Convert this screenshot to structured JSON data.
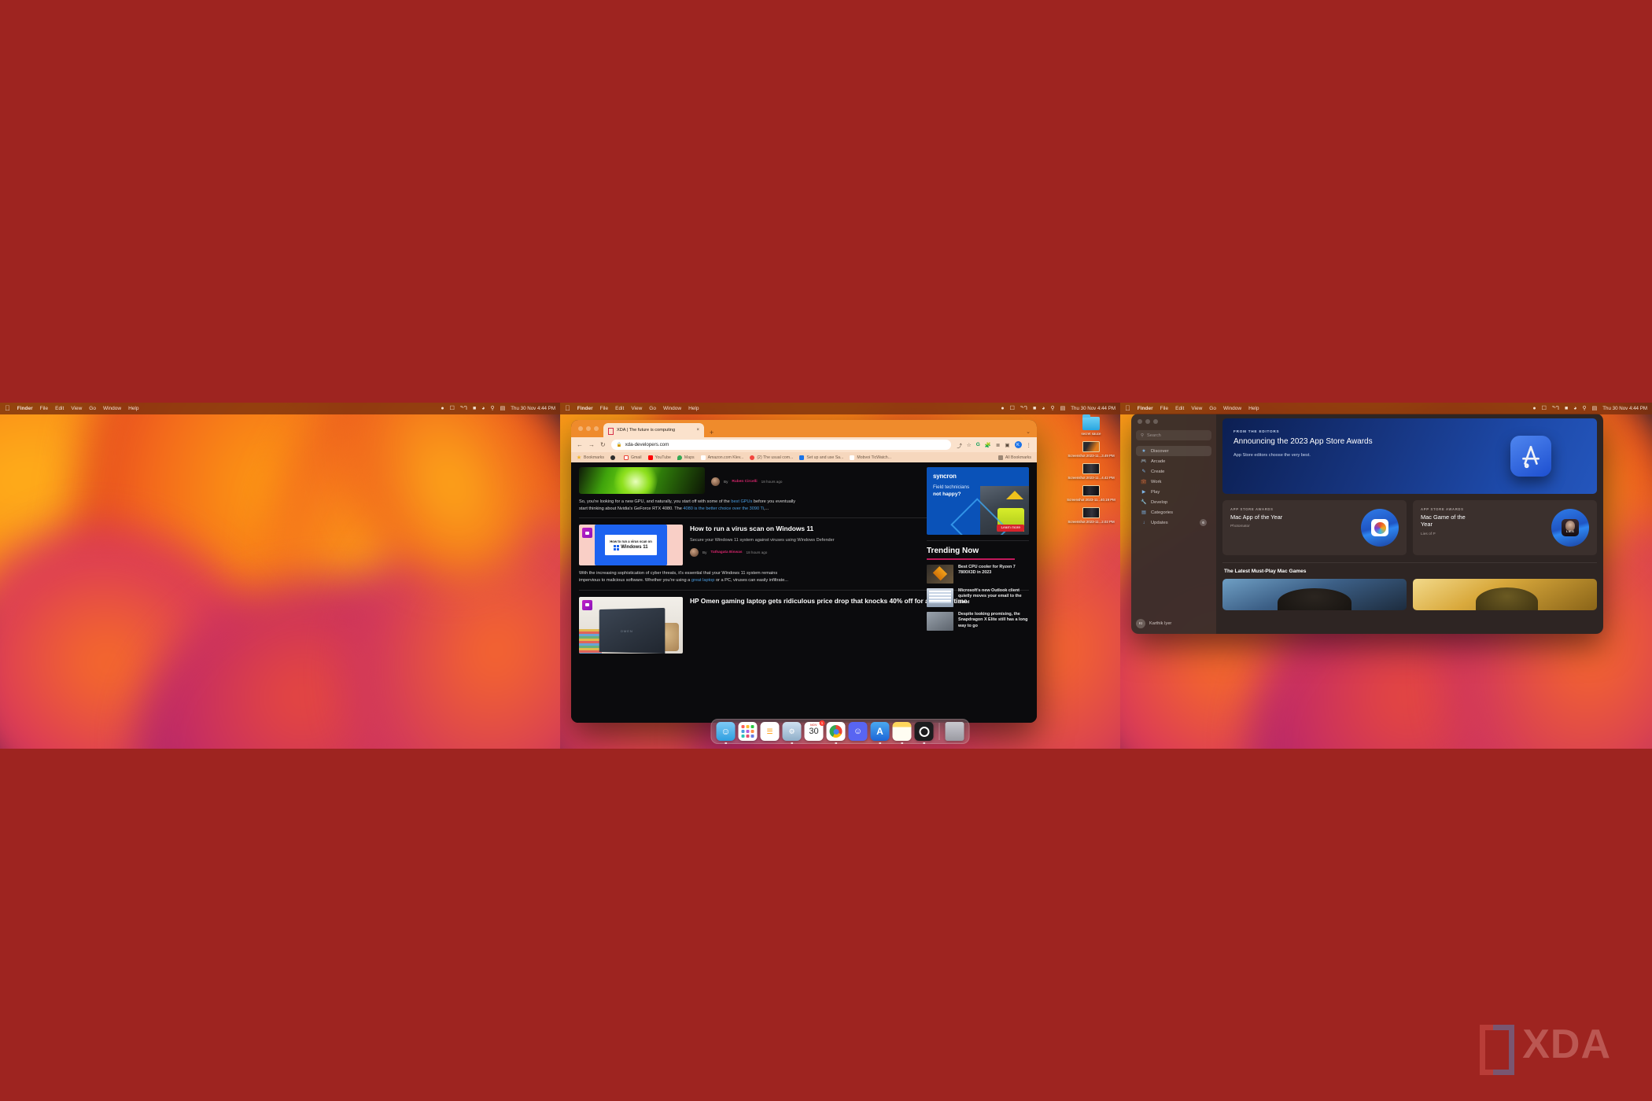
{
  "desktop": {
    "wallpaper_name": "macOS Ventura",
    "background_color": "#9e2420",
    "watermark": "XDA"
  },
  "menubar": {
    "apple": "",
    "items": [
      "Finder",
      "File",
      "Edit",
      "View",
      "Go",
      "Window",
      "Help"
    ],
    "status_icons": [
      "do-not-disturb-icon",
      "screen-mirroring-icon",
      "bluetooth-icon",
      "battery-icon",
      "wifi-icon",
      "search-icon",
      "control-center-icon"
    ],
    "clock": "Thu 30 Nov  4:44 PM"
  },
  "browser": {
    "traffic_lights": [
      "close",
      "minimize",
      "zoom"
    ],
    "tab": {
      "title": "XDA | The future is computing",
      "favicon": "xda-bracket-icon",
      "close": "×"
    },
    "new_tab": "+",
    "tab_list_chevron": "⌄",
    "toolbar": {
      "back": "←",
      "forward": "→",
      "reload": "↻",
      "lock": "🔒",
      "url": "xda-developers.com",
      "share": "⤴",
      "bookmark_star": "☆",
      "grammarly": "G",
      "extensions": "🧩",
      "reading_list": "≣",
      "side_panel": "▣",
      "profile_initial": "K",
      "menu": "⋮"
    },
    "bookmarks": [
      {
        "label": "Bookmarks",
        "color": "#f0b429"
      },
      {
        "label": "",
        "color": "#2d2d2d"
      },
      {
        "label": "Gmail",
        "color": "#ea4335"
      },
      {
        "label": "YouTube",
        "color": "#ff0000"
      },
      {
        "label": "Maps",
        "color": "#34a853"
      },
      {
        "label": "Amazon.com  Klev...",
        "color": "#ffffff"
      },
      {
        "label": "(2) The usual com...",
        "color": "#f2453d"
      },
      {
        "label": "Set up and use Sa...",
        "color": "#1a73e8"
      },
      {
        "label": "Mobvoi TicWatch...",
        "color": "#8a2be2"
      }
    ],
    "all_bookmarks": "All Bookmarks",
    "page": {
      "top_article": {
        "byline_prefix": "By",
        "author": "Ruben Circelli",
        "time": "18 hours ago",
        "excerpt_pre": "So, you're looking for a new GPU, and naturally, you start off with some of the ",
        "excerpt_link1": "best GPUs",
        "excerpt_mid": " before you eventually start thinking about Nvidia's GeForce RTX 4080. The ",
        "excerpt_link2": "4080 is the better choice over the 3090 Ti",
        "excerpt_post": ",..."
      },
      "articles": [
        {
          "title": "How to run a virus scan on Windows 11",
          "desc": "Secure your Windows 11 system against viruses using Windows Defender",
          "byline_prefix": "By",
          "author": "Tathagata Biswas",
          "time": "18 hours ago",
          "thumb_line1": "How to run a virus scan on",
          "thumb_line2": "Windows 11",
          "excerpt_pre": "With the increasing sophistication of cyber threats, it's essential that your Windows 11 system remains impervious to malicious software. Whether you're using a ",
          "excerpt_link": "great laptop",
          "excerpt_post": " or a PC, viruses can easily infiltrate..."
        },
        {
          "title": "HP Omen gaming laptop gets ridiculous price drop that knocks 40% off for a limited time",
          "thumb_label": "OMEN"
        }
      ],
      "ad": {
        "brand": "syncron",
        "line1": "Field technicians",
        "line2": "not happy?",
        "cta": "Learn more"
      },
      "trending": {
        "heading": "Trending Now",
        "items": [
          "Best CPU cooler for Ryzen 7 7800X3D in 2023",
          "Microsoft's new Outlook client quietly moves your email to the cloud",
          "Despite looking promising, the Snapdragon X Elite still has a long way to go"
        ]
      }
    }
  },
  "desktop_icons": [
    {
      "name": "secret sauce",
      "type": "folder"
    },
    {
      "name": "Screenshot 2023-11...3.49 PM",
      "type": "screenshot"
    },
    {
      "name": "Screenshot 2023-11...4.42 PM",
      "type": "screenshot"
    },
    {
      "name": "Screenshot 2023-11...40.19 PM",
      "type": "screenshot"
    },
    {
      "name": "Screenshot 2023-11...2.02 PM",
      "type": "screenshot"
    }
  ],
  "dock": {
    "apps": [
      {
        "name": "Finder",
        "running": true
      },
      {
        "name": "Launchpad",
        "running": false
      },
      {
        "name": "Reminders",
        "running": false
      },
      {
        "name": "System Settings",
        "running": true
      },
      {
        "name": "Calendar",
        "running": false,
        "month": "NOV",
        "day": "30",
        "badge": "1"
      },
      {
        "name": "Google Chrome",
        "running": true
      },
      {
        "name": "Discord",
        "running": false
      },
      {
        "name": "App Store",
        "running": true
      },
      {
        "name": "Notes",
        "running": true
      },
      {
        "name": "OBS",
        "running": true
      }
    ],
    "trash": "Trash"
  },
  "app_store": {
    "search_placeholder": "Search",
    "sidebar": [
      {
        "label": "Discover",
        "icon": "star-icon",
        "active": true
      },
      {
        "label": "Arcade",
        "icon": "arcade-icon",
        "active": false
      },
      {
        "label": "Create",
        "icon": "create-icon",
        "active": false
      },
      {
        "label": "Work",
        "icon": "work-icon",
        "active": false
      },
      {
        "label": "Play",
        "icon": "play-icon",
        "active": false
      },
      {
        "label": "Develop",
        "icon": "develop-icon",
        "active": false
      },
      {
        "label": "Categories",
        "icon": "categories-icon",
        "active": false
      },
      {
        "label": "Updates",
        "icon": "updates-icon",
        "active": false,
        "badge": "6"
      }
    ],
    "user": {
      "name": "Karthik Iyer",
      "initials": "KI"
    },
    "hero": {
      "kicker": "FROM THE EDITORS",
      "title": "Announcing the 2023 App Store Awards",
      "subtitle": "App Store editors choose the very best."
    },
    "award_cards": [
      {
        "kicker": "APP STORE AWARDS",
        "title": "Mac App of the Year",
        "app": "Photomator"
      },
      {
        "kicker": "APP STORE AWARDS",
        "title": "Mac Game of the Year",
        "app": "Lies of P"
      }
    ],
    "section_title": "The Latest Must-Play Mac Games"
  }
}
